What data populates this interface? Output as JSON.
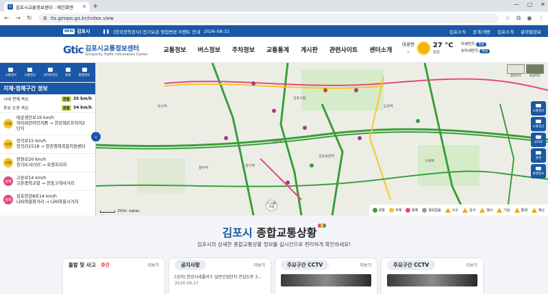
{
  "browser": {
    "tab_title": "김포시교통정보센터 : 메인화면",
    "url": "its.gimpo.go.kr/index.view"
  },
  "topstrip": {
    "city": "김포시",
    "badge": "NEW",
    "notice_text": "[한국전력공사] 전기요금 영업변경 이벤트 안내",
    "notice_date": "2026-08-31",
    "links": [
      "김포소식",
      "공개/개방",
      "김포소개",
      "분야별정보"
    ]
  },
  "header": {
    "logo_mark": "Gtic",
    "logo_title": "김포시교통정보센터",
    "logo_sub": "Gimpocity Traffic Information Center",
    "menu": [
      "교통정보",
      "버스정보",
      "주차정보",
      "교통통계",
      "게시판",
      "관련사이트",
      "센터소개"
    ],
    "weather": {
      "location": "대곶면",
      "temperature": "27 °C",
      "condition": "맑음",
      "fine_dust_label": "미세먼지",
      "fine_dust_value": "좋음",
      "ultrafine_label": "초미세먼지",
      "ultrafine_value": "좋음"
    }
  },
  "leftpanel": {
    "icons": [
      "소통정보",
      "소통영상",
      "교차로영상",
      "돌발",
      "통행정보"
    ],
    "title": "지체·정체구간 정보",
    "speeds": [
      {
        "label": "시내 전체 속도",
        "status": "원활",
        "value": "35 km/h"
      },
      {
        "label": "주요 도로 속도",
        "status": "원활",
        "value": "34 km/h"
      }
    ],
    "jams": [
      {
        "status": "지체",
        "color": "yellow",
        "line1": "태공경단로19 km/h",
        "line2": "자이퍼런이인끼즘 → 한강헤르프자이2",
        "line3": "단지"
      },
      {
        "status": "지체",
        "color": "yellow",
        "line1": "양곡로15 km/h",
        "line2": "양곡리1518 → 양촌행복복합지원센터",
        "line3": ""
      },
      {
        "status": "지체",
        "color": "yellow",
        "line1": "전원로20 km/h",
        "line2": "장기IC사거리 → 호영프라자",
        "line3": ""
      },
      {
        "status": "정체",
        "color": "pink",
        "line1": "고송로14 km/h",
        "line2": "고촌종학교앞 → 천동고개사거리",
        "line3": ""
      },
      {
        "status": "정체",
        "color": "pink",
        "line1": "김포한강8로14 km/h",
        "line2": "나비마을청거리 → 나비마을시거리",
        "line3": ""
      }
    ]
  },
  "map": {
    "toggle_normal": "일반지도",
    "toggle_satellite": "위성지도",
    "side_buttons": [
      "소통정보",
      "소통영상",
      "교차로",
      "돌발",
      "통행정보"
    ],
    "scale": "250m",
    "provider": "kakao",
    "loc_button": "스크롤 이동",
    "labels": [
      "풍무역",
      "김포시청",
      "사우역",
      "장기역",
      "걸포북변역",
      "구래역",
      "마산역",
      "운양역"
    ],
    "legend": [
      "원활",
      "지체",
      "정체",
      "정보없음",
      "사고",
      "공사",
      "행사",
      "기상",
      "통제",
      "재난"
    ],
    "legend_colors": {
      "good": "#3a9d3a",
      "slow": "#f6c42c",
      "jam": "#e8467c",
      "none": "#999999"
    }
  },
  "bottom": {
    "title_blue": "김포시",
    "title_rest": " 종합교통상황",
    "subtitle": "김포시의 상세한 종합교통상황 정보를 실시간으로 편리하게 확인하세요!",
    "cards": [
      {
        "title": "돌발 및 사고",
        "count": "0건",
        "more": "더보기"
      },
      {
        "title": "공지사항",
        "more": "더보기",
        "item": "[공지] 한강시네폴리스 일반산업단지 진입도로 3...",
        "date": "2026-08-27"
      },
      {
        "title": "주요구간 CCTV",
        "more": "더보기"
      },
      {
        "title": "주요구간 CCTV",
        "more": "더보기"
      }
    ]
  }
}
